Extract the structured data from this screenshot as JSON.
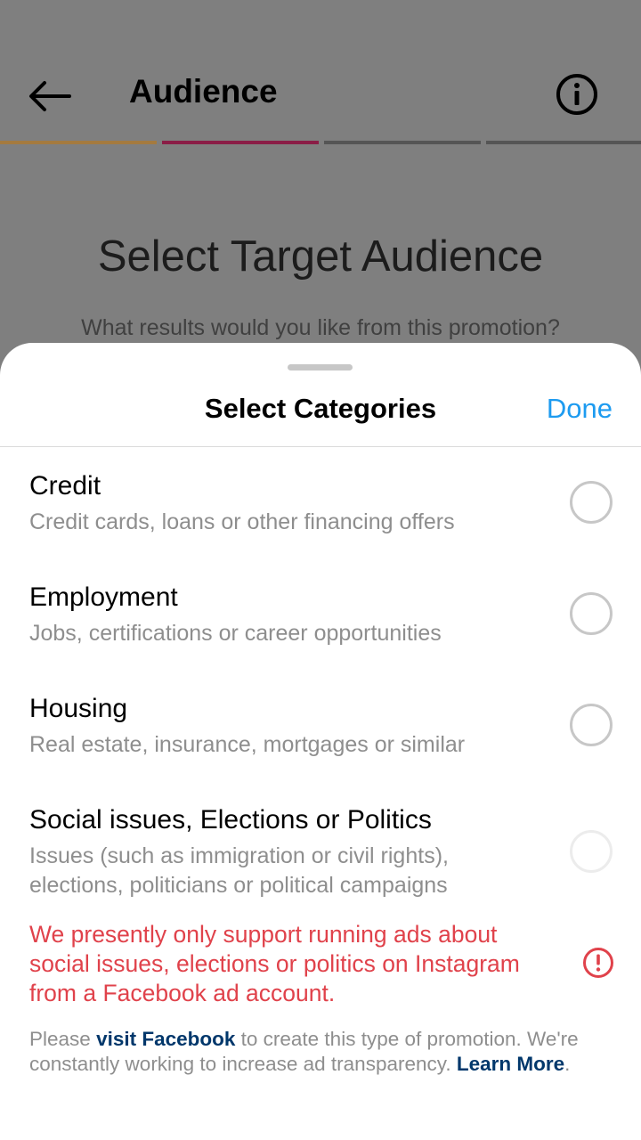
{
  "header": {
    "title": "Audience",
    "back_icon": "arrow-left-icon",
    "info_icon": "info-icon"
  },
  "progress": {
    "steps_total": 4,
    "colors": [
      "#a47a3f",
      "#8a1d46",
      "#555555",
      "#555555"
    ]
  },
  "background": {
    "heading": "Select Target Audience",
    "subheading": "What results would you like from this promotion?"
  },
  "sheet": {
    "title": "Select Categories",
    "done_label": "Done",
    "categories": [
      {
        "title": "Credit",
        "description": "Credit cards, loans or other financing offers",
        "selected": false,
        "enabled": true
      },
      {
        "title": "Employment",
        "description": "Jobs, certifications or career opportunities",
        "selected": false,
        "enabled": true
      },
      {
        "title": "Housing",
        "description": "Real estate, insurance, mortgages or similar",
        "selected": false,
        "enabled": true
      },
      {
        "title": "Social issues, Elections or Politics",
        "description": "Issues (such as immigration or civil rights), elections, politicians or political campaigns",
        "selected": false,
        "enabled": false
      }
    ],
    "warning": "We presently only support running ads about social issues, elections or politics on Instagram from a Facebook ad account.",
    "note": {
      "prefix": "Please ",
      "link1": "visit Facebook",
      "middle": " to create this type of promotion. We're constantly working to increase ad transparency. ",
      "link2": "Learn More",
      "suffix": "."
    }
  },
  "colors": {
    "accent": "#1d9bf0",
    "warning": "#e0424b",
    "link": "#00376b",
    "overlay": "#7f7f7f"
  }
}
